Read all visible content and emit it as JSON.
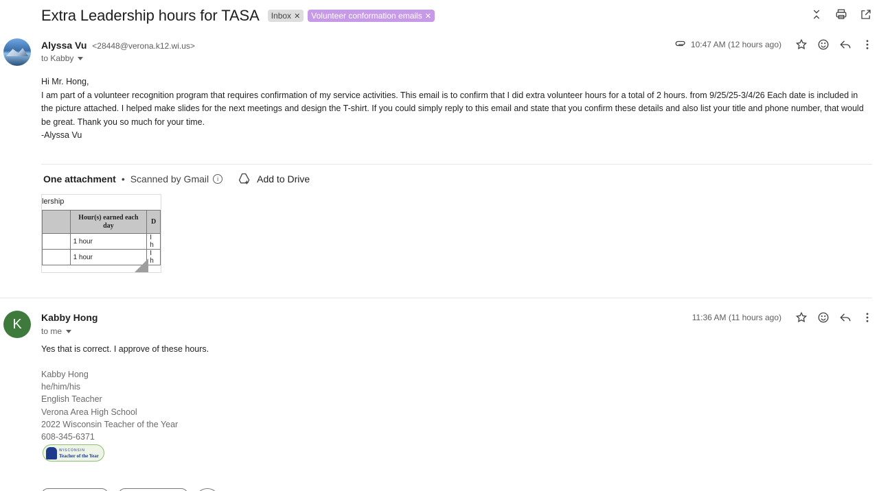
{
  "thread": {
    "subject": "Extra Leadership hours for TASA",
    "labels": [
      {
        "name": "Inbox",
        "color": "#dddddd"
      },
      {
        "name": "Volunteer conformation emails",
        "color": "#c79ae8"
      }
    ],
    "top_actions": [
      "collapse-all-icon",
      "print-icon",
      "open-new-window-icon"
    ]
  },
  "message1": {
    "sender_name": "Alyssa Vu",
    "sender_email": "<28448@verona.k12.wi.us>",
    "to": "to Kabby",
    "time": "10:47 AM (12 hours ago)",
    "has_attachment_icon": true,
    "body": [
      "Hi Mr. Hong,",
      "I am part of a volunteer recognition program that requires confirmation of my service activities. This email is to confirm that I did extra volunteer hours for a total of 2 hours. from 9/25/25-3/4/26 Each date is included in the picture attached. I helped make slides for the next meetings and design the T-shirt. If you could simply reply to this email and state that you confirm these details and also list your title and phone number, that would be great. Thank you so much for your time.",
      "-Alyssa Vu"
    ],
    "attachments": {
      "title": "One attachment",
      "scanned": "Scanned by Gmail",
      "add_to_drive": "Add to Drive",
      "thumbnail": {
        "caption": "lership",
        "header": "Hour(s) earned each day",
        "header_next": "D",
        "rows": [
          {
            "hours": "1 hour",
            "next": "I h"
          },
          {
            "hours": "1 hour",
            "next": "I h"
          }
        ]
      }
    }
  },
  "message2": {
    "avatar_letter": "K",
    "avatar_color": "#3d7a3b",
    "sender_name": "Kabby Hong",
    "to": "to me",
    "time": "11:36 AM (11 hours ago)",
    "body": "Yes that is correct. I approve of these hours.",
    "signature": [
      "Kabby Hong",
      "he/him/his",
      "English Teacher",
      "Verona Area High School",
      "2022 Wisconsin Teacher of the Year",
      "608-345-6371"
    ],
    "logo": {
      "small": "WISCONSIN",
      "big": "Teacher of the Year"
    }
  }
}
